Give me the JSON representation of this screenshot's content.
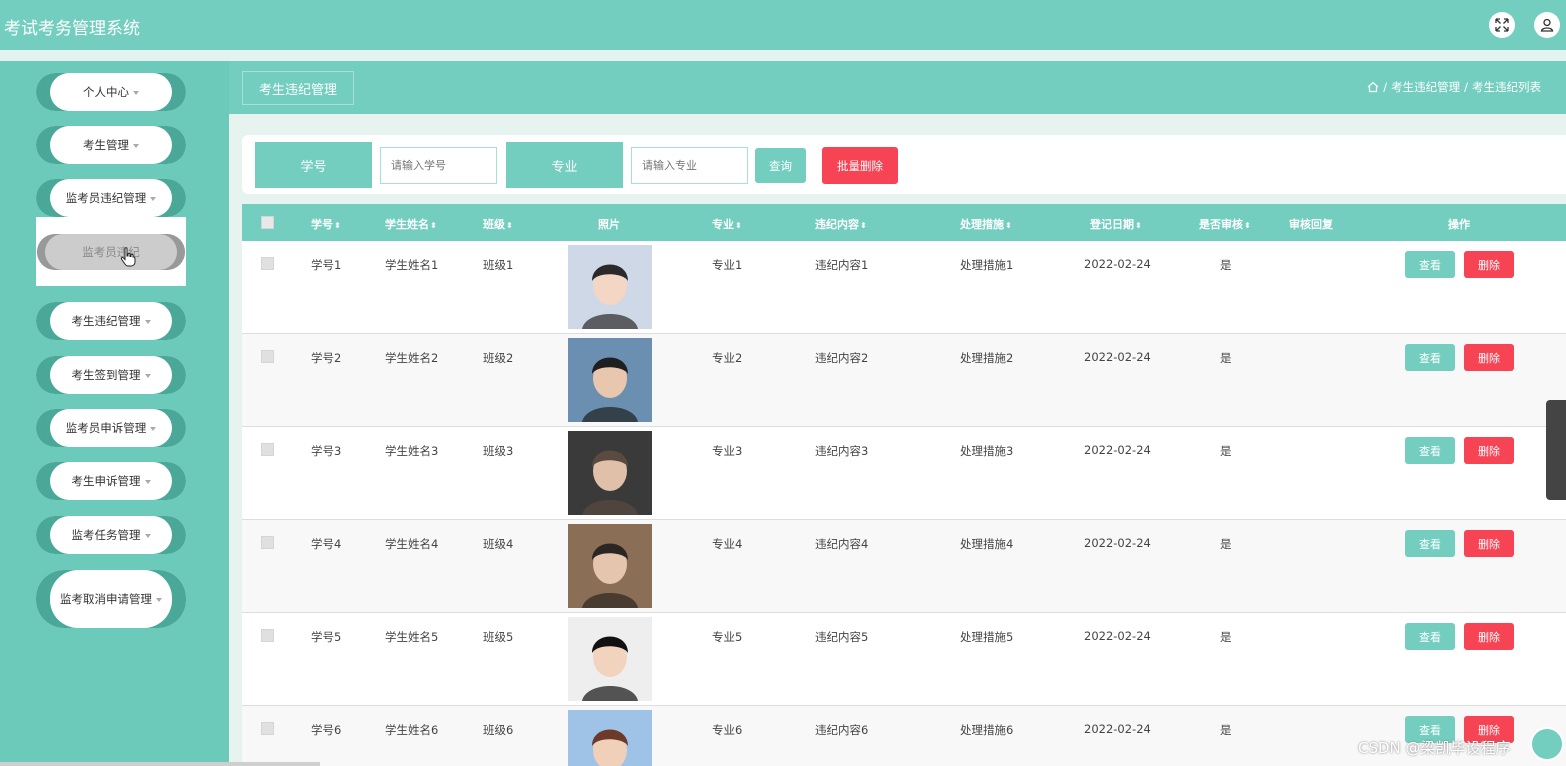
{
  "app": {
    "title": "考试考务管理系统"
  },
  "sidebar": {
    "items": [
      {
        "label": "个人中心"
      },
      {
        "label": "考生管理"
      },
      {
        "label": "监考员违纪管理"
      },
      {
        "label": "考生违纪管理"
      },
      {
        "label": "考生签到管理"
      },
      {
        "label": "监考员申诉管理"
      },
      {
        "label": "考生申诉管理"
      },
      {
        "label": "监考任务管理"
      },
      {
        "label": "监考取消申请管理"
      }
    ],
    "submenu_item": "监考员违纪"
  },
  "crumbbar": {
    "tab": "考生违纪管理",
    "breadcrumb": [
      "考生违纪管理",
      "考生违纪列表"
    ],
    "separator": "/"
  },
  "search": {
    "label1": "学号",
    "placeholder1": "请输入学号",
    "label2": "专业",
    "placeholder2": "请输入专业",
    "query_button": "查询",
    "batch_delete_button": "批量删除"
  },
  "table": {
    "headers": [
      "学号",
      "学生姓名",
      "班级",
      "照片",
      "专业",
      "违纪内容",
      "处理措施",
      "登记日期",
      "是否审核",
      "审核回复",
      "操作"
    ],
    "sort_glyph": "⬍",
    "rows": [
      {
        "id": "学号1",
        "name": "学生姓名1",
        "class": "班级1",
        "major": "专业1",
        "content": "违纪内容1",
        "measure": "处理措施1",
        "date": "2022-02-24",
        "audited": "是",
        "reply": ""
      },
      {
        "id": "学号2",
        "name": "学生姓名2",
        "class": "班级2",
        "major": "专业2",
        "content": "违纪内容2",
        "measure": "处理措施2",
        "date": "2022-02-24",
        "audited": "是",
        "reply": ""
      },
      {
        "id": "学号3",
        "name": "学生姓名3",
        "class": "班级3",
        "major": "专业3",
        "content": "违纪内容3",
        "measure": "处理措施3",
        "date": "2022-02-24",
        "audited": "是",
        "reply": ""
      },
      {
        "id": "学号4",
        "name": "学生姓名4",
        "class": "班级4",
        "major": "专业4",
        "content": "违纪内容4",
        "measure": "处理措施4",
        "date": "2022-02-24",
        "audited": "是",
        "reply": ""
      },
      {
        "id": "学号5",
        "name": "学生姓名5",
        "class": "班级5",
        "major": "专业5",
        "content": "违纪内容5",
        "measure": "处理措施5",
        "date": "2022-02-24",
        "audited": "是",
        "reply": ""
      },
      {
        "id": "学号6",
        "name": "学生姓名6",
        "class": "班级6",
        "major": "专业6",
        "content": "违纪内容6",
        "measure": "处理措施6",
        "date": "2022-02-24",
        "audited": "是",
        "reply": ""
      }
    ],
    "view_button": "查看",
    "delete_button": "删除"
  },
  "watermark": "CSDN @梁凯毕设程序",
  "colors": {
    "accent": "#73cec0",
    "danger": "#f64454",
    "sidebar": "#6ccabb"
  }
}
